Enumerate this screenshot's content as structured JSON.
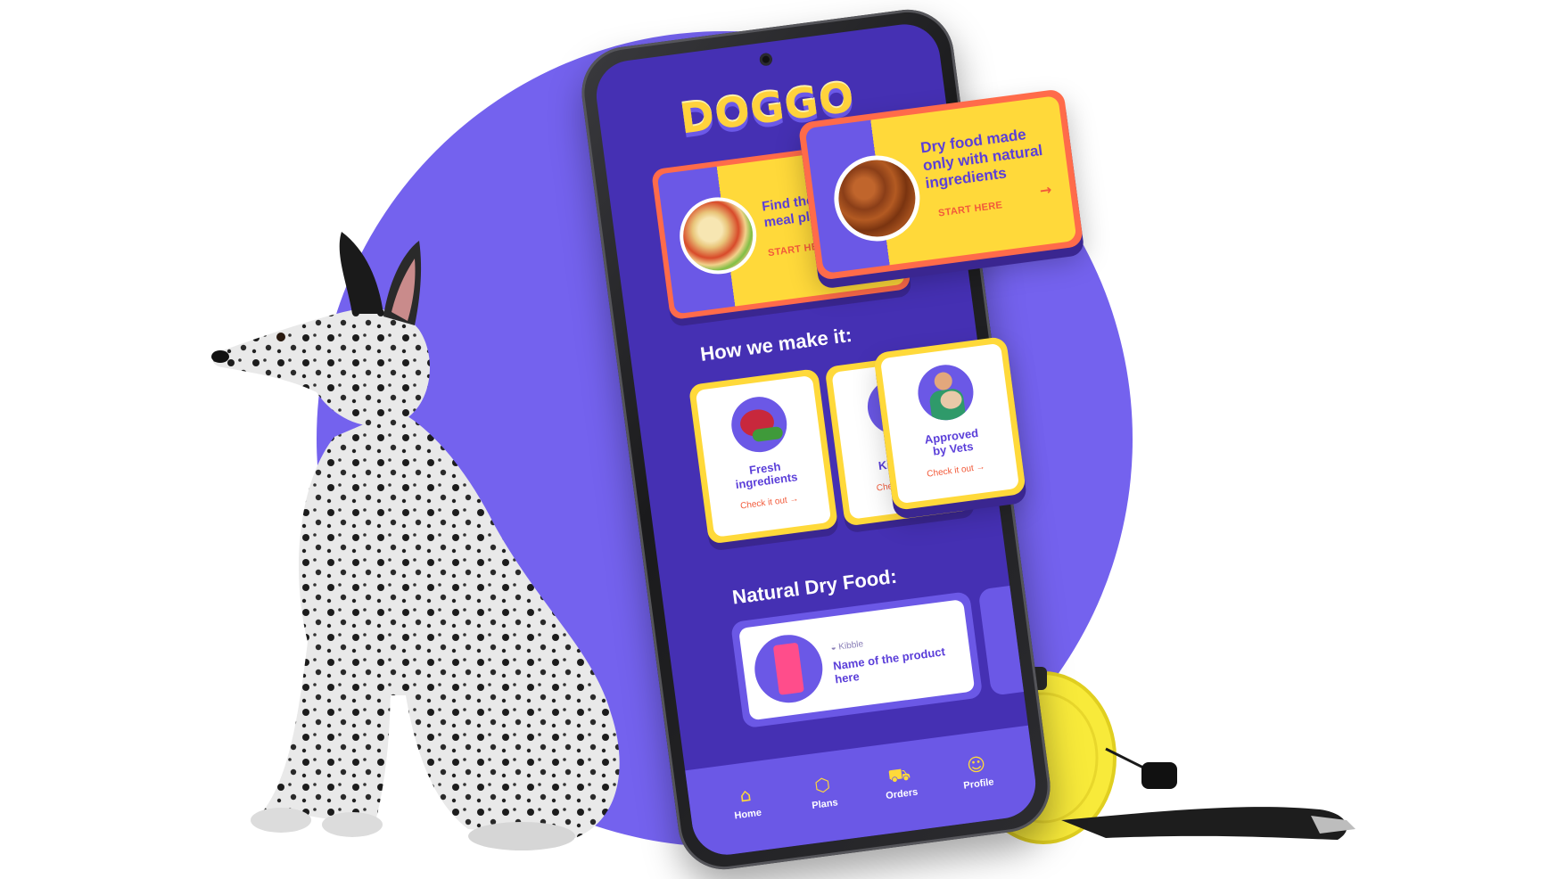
{
  "brand": {
    "logo_text": "DOGGO"
  },
  "colors": {
    "primary": "#4530b3",
    "accent_purple": "#6b58e6",
    "accent_yellow": "#ffd93a",
    "accent_coral": "#ff6b4a",
    "background_circle": "#7462ee"
  },
  "hero_cards": [
    {
      "title_line1": "Find the perfect",
      "title_line2": "meal plan",
      "cta": "START HERE",
      "arrow_icon": "arrow-right-icon"
    },
    {
      "title_line1": "Dry food made",
      "title_line2": "only with natural",
      "title_line3": "ingredients",
      "cta": "START HERE",
      "arrow_icon": "arrow-right-icon"
    }
  ],
  "how_section": {
    "title": "How we make it:",
    "cards": [
      {
        "title_line1": "Fresh",
        "title_line2": "ingredients",
        "cta": "Check it out"
      },
      {
        "title_line1": "Safe",
        "title_line2": "Kitchens",
        "cta": "Check it out"
      },
      {
        "title_line1": "Approved",
        "title_line2": "by Vets",
        "cta": "Check it out"
      }
    ]
  },
  "dry_food_section": {
    "title": "Natural Dry Food:",
    "product": {
      "tag": "Kibble",
      "name": "Name of the product here"
    }
  },
  "bottom_nav": {
    "items": [
      {
        "label": "Home",
        "icon": "home-icon"
      },
      {
        "label": "Plans",
        "icon": "box-icon"
      },
      {
        "label": "Orders",
        "icon": "truck-icon"
      },
      {
        "label": "Profile",
        "icon": "user-icon"
      }
    ]
  }
}
